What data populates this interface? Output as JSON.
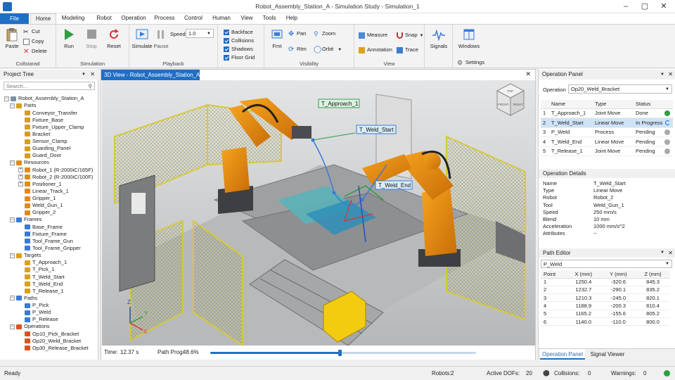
{
  "window": {
    "title": "Robot_Assembly_Station_A - Simulation Study - Simulation_1"
  },
  "menu": {
    "file": "File",
    "tabs": [
      "Home",
      "Modeling",
      "Robot",
      "Operation",
      "Process",
      "Control",
      "Human",
      "View",
      "Tools",
      "Help"
    ]
  },
  "ribbon": {
    "clipboard": {
      "label": "Collstarad",
      "paste": "Paste",
      "cut": "Cut",
      "copy": "Copy",
      "delete": "Delete"
    },
    "simulation": {
      "label": "Simulation",
      "run": "Run",
      "stop": "Stop",
      "reset": "Reset"
    },
    "playback": {
      "label": "Playback",
      "simulate": "Simulate",
      "pause": "Pause",
      "speed_label": "Speed",
      "speed_value": "1.0"
    },
    "display": {
      "backface": "Backface",
      "collisions": "Collisions",
      "shadows": "Shadows",
      "floor_grid": "Floor Grid"
    },
    "visibility": {
      "label": "Visibility",
      "front": "Frnt",
      "pan": "Pan",
      "zoom": "Zoom",
      "rotate": "Rtm",
      "orbit": "Orbit"
    },
    "view": {
      "label": "View",
      "measure": "Measure",
      "snap": "Snap",
      "annotation": "Annotation",
      "trace": "Trace"
    },
    "signals": "Signals",
    "windows": "Windows",
    "settings": "Settings"
  },
  "tree": {
    "title": "Project Tree",
    "search_placeholder": "Search...",
    "root": "Robot_Assembly_Station_A",
    "groups": [
      {
        "name": "Parts",
        "color": "#d4a017",
        "items": [
          "Conveyor_Transfer",
          "Fixture_Base",
          "Fixture_Upper_Clamp",
          "Bracket",
          "Sensor_Clamp",
          "Guarding_Panel",
          "Guard_Door"
        ]
      },
      {
        "name": "Resources",
        "color": "#e08a1a",
        "items": [
          "Robot_1 (R-2000iC/165F)",
          "Robot_2 (R-2000iC/100F)",
          "Positioner_1",
          "Linear_Track_1",
          "Gripper_1",
          "Weld_Gun_1",
          "Gripper_2"
        ]
      },
      {
        "name": "Frames",
        "color": "#3a7bd5",
        "items": [
          "Base_Frame",
          "Fixture_Frame",
          "Tool_Frame_Gun",
          "Tool_Frame_Gripper"
        ]
      },
      {
        "name": "Targets",
        "color": "#d9a21b",
        "items": [
          "T_Approach_1",
          "T_Pick_1",
          "T_Weld_Start",
          "T_Weld_End",
          "T_Release_1"
        ]
      },
      {
        "name": "Paths",
        "color": "#3a7bd5",
        "items": [
          "P_Pick",
          "P_Weld",
          "P_Release"
        ]
      },
      {
        "name": "Operations",
        "color": "#d9531e",
        "items": [
          "Op10_Pick_Bracket",
          "Op20_Weld_Bracket",
          "Op30_Release_Bracket"
        ]
      }
    ]
  },
  "view3d": {
    "tab_title": "3D View - Robot_Assembly_Station_A",
    "labels": {
      "approach": "T_Approach_1",
      "weld_start": "T_Weld_Start",
      "weld_end": "T_Weld_End"
    },
    "cube": {
      "top": "TOP",
      "front": "FRONT",
      "right": "RIGHT"
    },
    "axes": {
      "x": "X",
      "y": "Y",
      "z": "Z"
    },
    "time_label": "Time:",
    "time_value": "12.37 s",
    "prog_label": "Path Prog:",
    "prog_value": "48.6%",
    "progress": 0.486
  },
  "operation_panel": {
    "title": "Operation Panel",
    "operation_label": "Operation",
    "operation_value": "Op20_Weld_Bracket",
    "headers": [
      "Name",
      "Type",
      "Status"
    ],
    "rows": [
      {
        "n": "1",
        "name": "T_Approach_1",
        "type": "Joint Move",
        "status": "Done"
      },
      {
        "n": "2",
        "name": "T_Weld_Start",
        "type": "Linear Move",
        "status": "In Progress"
      },
      {
        "n": "3",
        "name": "P_Weld",
        "type": "Process",
        "status": "Pending"
      },
      {
        "n": "4",
        "name": "T_Weld_End",
        "type": "Linear Move",
        "status": "Pending"
      },
      {
        "n": "5",
        "name": "T_Release_1",
        "type": "Joint Move",
        "status": "Pending"
      }
    ]
  },
  "details": {
    "title": "Operation Details",
    "fields": [
      {
        "k": "Name",
        "v": "T_Weld_Start"
      },
      {
        "k": "Type",
        "v": "Linear Move"
      },
      {
        "k": "Robot",
        "v": "Robot_2"
      },
      {
        "k": "Tool",
        "v": "Weld_Gun_1"
      },
      {
        "k": "Speed",
        "v": "250 mm/s"
      },
      {
        "k": "Blend",
        "v": "10 mm"
      },
      {
        "k": "Acceleration",
        "v": "1000 mm/s^2"
      },
      {
        "k": "Attributes",
        "v": "--"
      }
    ]
  },
  "path_editor": {
    "title": "Path Editor",
    "path": "P_Weld",
    "headers": [
      "Point",
      "X (mm)",
      "Y (mm)",
      "Z (mm)"
    ],
    "rows": [
      [
        "1",
        "1250.4",
        "-320.6",
        "845.3"
      ],
      [
        "2",
        "1232.7",
        "-290.1",
        "835.2"
      ],
      [
        "3",
        "1210.3",
        "-245.0",
        "820.1"
      ],
      [
        "4",
        "1188.9",
        "-200.3",
        "810.4"
      ],
      [
        "5",
        "1165.2",
        "-155.6",
        "805.2"
      ],
      [
        "6",
        "1140.0",
        "-110.0",
        "800.0"
      ]
    ],
    "tabs": [
      "Operation Panel",
      "Signal Viewer"
    ]
  },
  "status": {
    "ready": "Ready",
    "robots_label": "Robots:",
    "robots": "2",
    "dofs_label": "Active DOFs:",
    "dofs": "20",
    "collisions_label": "Collisions:",
    "collisions": "0",
    "warnings_label": "Warnings:",
    "warnings": "0"
  }
}
